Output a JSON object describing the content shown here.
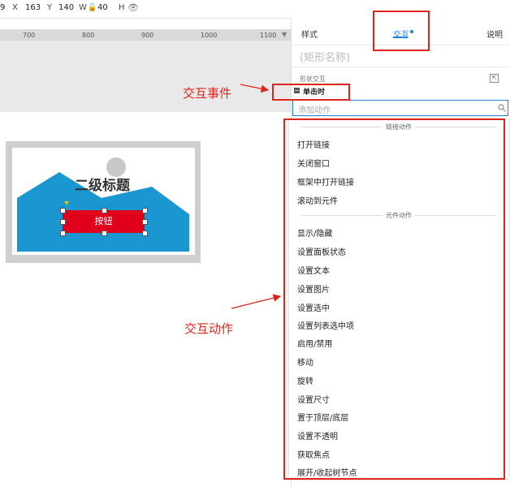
{
  "toolbar": {
    "y_prefix": "9",
    "x_label": "X",
    "x_value": "163",
    "y_label": "Y",
    "y_value": "140",
    "w_label": "W",
    "w_value": "40",
    "h_label": "H"
  },
  "ruler": {
    "labels": [
      "700",
      "800",
      "900",
      "1000",
      "1100"
    ]
  },
  "canvas": {
    "subtitle": "二级标题",
    "button_label": "按钮"
  },
  "annotations": {
    "event": "交互事件",
    "action": "交互动作"
  },
  "panel": {
    "tabs": [
      {
        "label": "样式",
        "active": false
      },
      {
        "label": "交互",
        "active": true
      },
      {
        "label": "说明",
        "active": false
      }
    ],
    "element_name_placeholder": "(矩形名称)",
    "shape_interaction_label": "形状交互",
    "event_label": "单击时",
    "search_placeholder": "添加动作",
    "accent_color": "#1a7fd6",
    "annotation_color": "#e0231b"
  },
  "dropdown": {
    "link_section": "链接动作",
    "link_actions": [
      "打开链接",
      "关闭窗口",
      "框架中打开链接",
      "滚动到元件"
    ],
    "widget_section": "元件动作",
    "widget_actions": [
      "显示/隐藏",
      "设置面板状态",
      "设置文本",
      "设置图片",
      "设置选中",
      "设置列表选中项",
      "启用/禁用",
      "移动",
      "旋转",
      "设置尺寸",
      "置于顶层/底层",
      "设置不透明",
      "获取焦点",
      "展开/收起树节点"
    ]
  }
}
